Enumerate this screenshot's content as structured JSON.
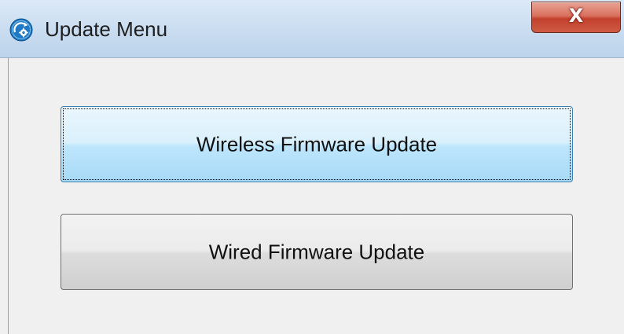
{
  "window": {
    "title": "Update Menu",
    "app_icon": "update-gear-icon",
    "close_glyph": "X",
    "close_icon": "close-icon"
  },
  "buttons": [
    {
      "label": "Wireless Firmware Update",
      "focused": true
    },
    {
      "label": "Wired Firmware Update",
      "focused": false
    }
  ],
  "colors": {
    "titlebar": "#c9dcf0",
    "client_background": "#f0f0f0",
    "close_button": "#c2402c",
    "focused_button_border": "#3c7fb1",
    "app_icon": "#1f79c4"
  }
}
